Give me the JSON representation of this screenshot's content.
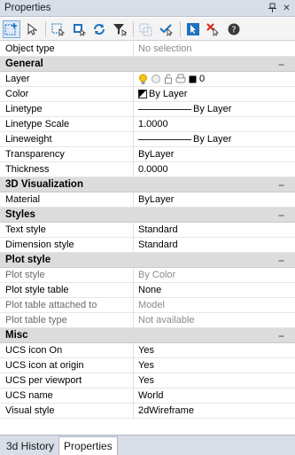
{
  "window": {
    "title": "Properties"
  },
  "header_row": {
    "name": "Object type",
    "value": "No selection"
  },
  "general": {
    "title": "General",
    "layer": {
      "name": "Layer",
      "value": "0"
    },
    "color": {
      "name": "Color",
      "value": "By Layer"
    },
    "linetype": {
      "name": "Linetype",
      "value": "By Layer"
    },
    "linetype_scale": {
      "name": "Linetype Scale",
      "value": "1.0000"
    },
    "lineweight": {
      "name": "Lineweight",
      "value": "By Layer"
    },
    "transparency": {
      "name": "Transparency",
      "value": "ByLayer"
    },
    "thickness": {
      "name": "Thickness",
      "value": "0.0000"
    }
  },
  "visualization": {
    "title": "3D Visualization",
    "material": {
      "name": "Material",
      "value": "ByLayer"
    }
  },
  "styles": {
    "title": "Styles",
    "text_style": {
      "name": "Text style",
      "value": "Standard"
    },
    "dimension_style": {
      "name": "Dimension style",
      "value": "Standard"
    }
  },
  "plot": {
    "title": "Plot style",
    "plot_style": {
      "name": "Plot style",
      "value": "By Color"
    },
    "plot_style_table": {
      "name": "Plot style table",
      "value": "None"
    },
    "plot_table_attached": {
      "name": "Plot table attached to",
      "value": "Model"
    },
    "plot_table_type": {
      "name": "Plot table type",
      "value": "Not available"
    }
  },
  "misc": {
    "title": "Misc",
    "ucs_icon_on": {
      "name": "UCS icon On",
      "value": "Yes"
    },
    "ucs_icon_origin": {
      "name": "UCS icon at origin",
      "value": "Yes"
    },
    "ucs_per_viewport": {
      "name": "UCS per viewport",
      "value": "Yes"
    },
    "ucs_name": {
      "name": "UCS name",
      "value": "World"
    },
    "visual_style": {
      "name": "Visual style",
      "value": "2dWireframe"
    }
  },
  "tabs": {
    "history": "3d History",
    "properties": "Properties"
  },
  "ui": {
    "collapse": "−",
    "pin": "ᵖ",
    "close": "✕"
  },
  "colors": {
    "accent": "#1e73be",
    "category_bg": "#dcdcdc",
    "titlebar_bg": "#d7dee8"
  }
}
